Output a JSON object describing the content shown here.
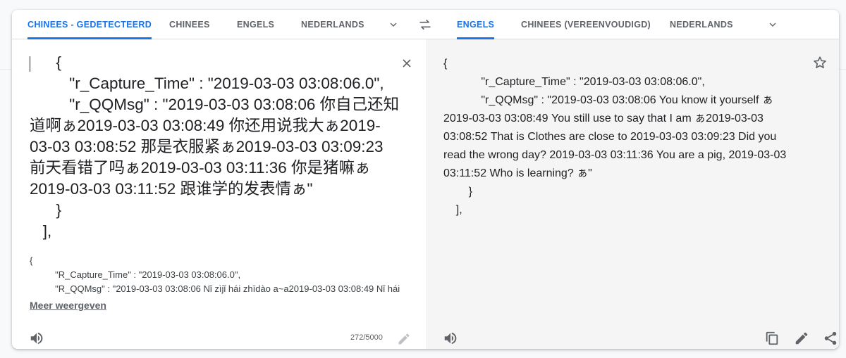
{
  "source_tabs": [
    "CHINEES - GEDETECTEERD",
    "CHINEES",
    "ENGELS",
    "NEDERLANDS"
  ],
  "target_tabs": [
    "ENGELS",
    "CHINEES (VEREENVOUDIGD)",
    "NEDERLANDS"
  ],
  "source": {
    "text": "      {\n         \"r_Capture_Time\" : \"2019-03-03 03:08:06.0\",\n         \"r_QQMsg\" : \"2019-03-03 03:08:06 你自己还知道啊ぁ2019-03-03 03:08:49 你还用说我大ぁ2019-03-03 03:08:52 那是衣服紧ぁ2019-03-03 03:09:23 前天看错了吗ぁ2019-03-03 03:11:36 你是猪嘛ぁ2019-03-03 03:11:52 跟谁学的发表情ぁ\"\n      }\n   ],",
    "transliteration": "{\n          \"R_Capture_Time\" : \"2019-03-03 03:08:06.0\",\n          \"R_QQMsg\" : \"2019-03-03 03:08:06 Nǐ zìjǐ hái zhīdào a~a2019-03-03 03:08:49 Nǐ hái",
    "show_more": "Meer weergeven",
    "char_count": "272/5000"
  },
  "target": {
    "text": "{\n            \"r_Capture_Time\" : \"2019-03-03 03:08:06.0\",\n            \"r_QQMsg\" : \"2019-03-03 03:08:06 You know it yourself ぁ 2019-03-03 03:08:49 You still use to say that I am ぁ2019-03-03 03:08:52 That is Clothes are close to 2019-03-03 03:09:23 Did you read the wrong day? 2019-03-03 03:11:36 You are a pig, 2019-03-03 03:11:52 Who is learning? ぁ\"\n        }\n    ],"
  },
  "colors": {
    "accent": "#1a73e8",
    "muted": "#5f6368",
    "text": "#202124"
  },
  "icons": [
    "chevron-down-icon",
    "swap-languages-icon",
    "close-icon",
    "speaker-icon",
    "pencil-icon",
    "star-icon",
    "copy-icon",
    "share-icon"
  ]
}
